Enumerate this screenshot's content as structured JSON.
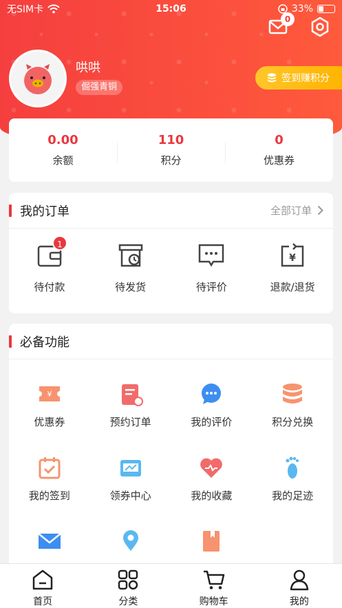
{
  "status_bar": {
    "carrier": "无SIM卡",
    "time": "15:06",
    "battery": "33%"
  },
  "header": {
    "message_count": "0",
    "username": "哄哄",
    "level": "倔强青铜",
    "signin_label": "签到赚积分"
  },
  "stats": [
    {
      "value": "0.00",
      "label": "余额"
    },
    {
      "value": "110",
      "label": "积分"
    },
    {
      "value": "0",
      "label": "优惠券"
    }
  ],
  "orders": {
    "title": "我的订单",
    "all_label": "全部订单",
    "items": [
      {
        "label": "待付款",
        "icon": "wallet-icon",
        "badge": "1"
      },
      {
        "label": "待发货",
        "icon": "box-clock-icon"
      },
      {
        "label": "待评价",
        "icon": "chat-dots-icon"
      },
      {
        "label": "退款/退货",
        "icon": "refund-icon"
      }
    ]
  },
  "tools": {
    "title": "必备功能",
    "items": [
      {
        "label": "优惠券",
        "icon": "coupon-icon",
        "color": "#f7936f"
      },
      {
        "label": "预约订单",
        "icon": "clipboard-icon",
        "color": "#f26b6b"
      },
      {
        "label": "我的评价",
        "icon": "comment-icon",
        "color": "#3d8ef0"
      },
      {
        "label": "积分兑换",
        "icon": "coins-icon",
        "color": "#f7936f"
      },
      {
        "label": "我的签到",
        "icon": "calendar-icon",
        "color": "#f7936f"
      },
      {
        "label": "领券中心",
        "icon": "coupon-center-icon",
        "color": "#5ab8f0"
      },
      {
        "label": "我的收藏",
        "icon": "heart-icon",
        "color": "#f26b6b"
      },
      {
        "label": "我的足迹",
        "icon": "footprint-icon",
        "color": "#5ab8f0"
      },
      {
        "label": "",
        "icon": "mail-icon",
        "color": "#3d8ef0"
      },
      {
        "label": "",
        "icon": "location-icon",
        "color": "#5ab8f0"
      },
      {
        "label": "",
        "icon": "book-icon",
        "color": "#f7936f"
      }
    ]
  },
  "tabbar": [
    {
      "label": "首页",
      "icon": "home-icon"
    },
    {
      "label": "分类",
      "icon": "category-icon"
    },
    {
      "label": "购物车",
      "icon": "cart-icon"
    },
    {
      "label": "我的",
      "icon": "profile-icon"
    }
  ]
}
